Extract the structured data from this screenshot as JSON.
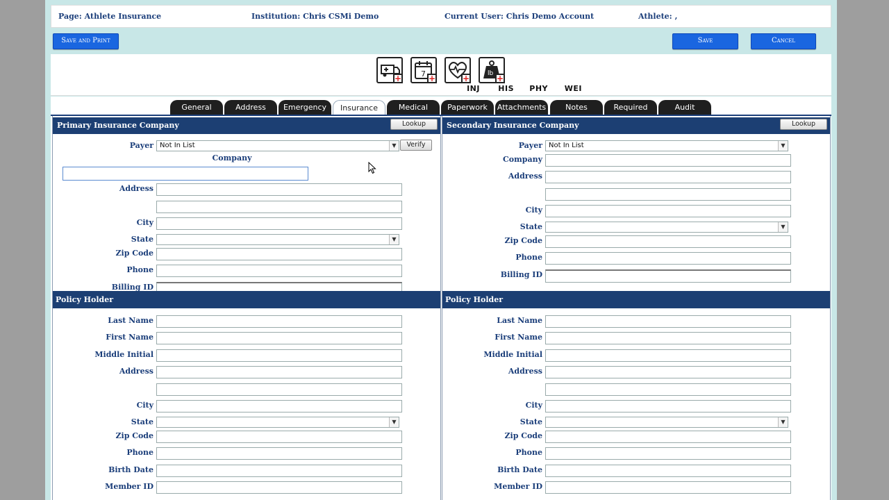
{
  "info": {
    "page": "Page: Athlete Insurance",
    "institution": "Institution: Chris CSMi Demo",
    "user": "Current User: Chris Demo Account",
    "athlete": "Athlete: ,"
  },
  "toolbar": {
    "save_print": "Save and Print",
    "save": "Save",
    "cancel": "Cancel"
  },
  "modules": [
    {
      "label": "INJ",
      "icon": "ambulance-icon"
    },
    {
      "label": "HIS",
      "icon": "calendar-icon"
    },
    {
      "label": "PHY",
      "icon": "heartbeat-icon"
    },
    {
      "label": "WEI",
      "icon": "weight-icon"
    }
  ],
  "tabs": [
    "General",
    "Address",
    "Emergency",
    "Insurance",
    "Medical",
    "Paperwork",
    "Attachments",
    "Notes",
    "Required",
    "Audit"
  ],
  "active_tab": "Insurance",
  "primary": {
    "title": "Primary Insurance Company",
    "lookup": "Lookup",
    "payer_label": "Payer",
    "payer_value": "Not In List",
    "verify": "Verify",
    "company_label": "Company",
    "address_label": "Address",
    "city_label": "City",
    "state_label": "State",
    "zip_label": "Zip Code",
    "phone_label": "Phone",
    "billing_label": "Billing ID"
  },
  "secondary": {
    "title": "Secondary Insurance Company",
    "lookup": "Lookup",
    "payer_label": "Payer",
    "payer_value": "Not In List",
    "company_label": "Company",
    "address_label": "Address",
    "city_label": "City",
    "state_label": "State",
    "zip_label": "Zip Code",
    "phone_label": "Phone",
    "billing_label": "Billing ID"
  },
  "policy": {
    "title": "Policy Holder",
    "last_name": "Last Name",
    "first_name": "First Name",
    "middle_initial": "Middle Initial",
    "address": "Address",
    "city": "City",
    "state": "State",
    "zip": "Zip Code",
    "phone": "Phone",
    "birth_date": "Birth Date",
    "member_id": "Member ID"
  },
  "colors": {
    "header_navy": "#1c3f73",
    "button_blue": "#1a66e0",
    "label_navy": "#1b3e7a",
    "page_bg": "#c8e7e7"
  }
}
